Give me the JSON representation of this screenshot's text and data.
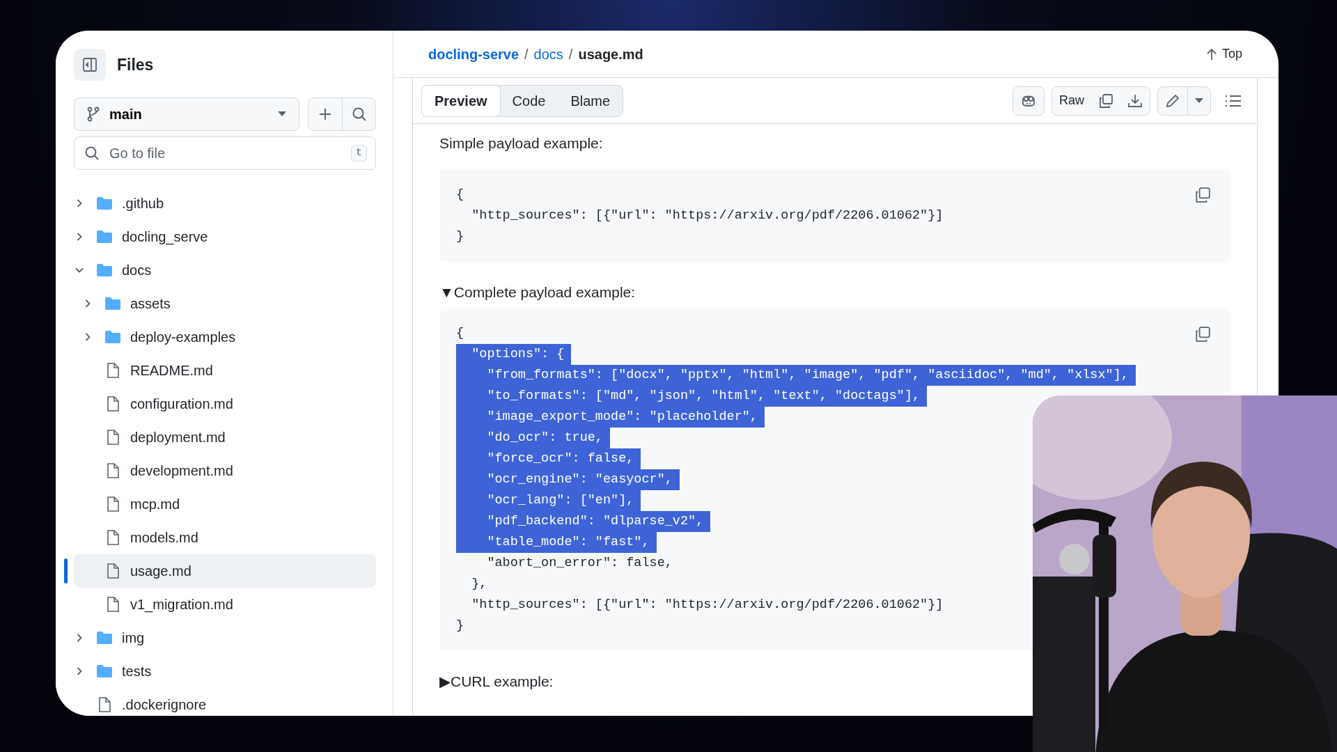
{
  "sidebar": {
    "title": "Files",
    "branch": "main",
    "search": {
      "placeholder": "Go to file",
      "shortcut": "t"
    },
    "tree": [
      {
        "kind": "folder",
        "name": ".github",
        "expanded": false,
        "selected": false
      },
      {
        "kind": "folder",
        "name": "docling_serve",
        "expanded": false,
        "selected": false
      },
      {
        "kind": "folder",
        "name": "docs",
        "expanded": true,
        "selected": false,
        "children": [
          {
            "kind": "folder",
            "name": "assets",
            "expanded": false,
            "selected": false
          },
          {
            "kind": "folder",
            "name": "deploy-examples",
            "expanded": false,
            "selected": false
          },
          {
            "kind": "file",
            "name": "README.md",
            "selected": false
          },
          {
            "kind": "file",
            "name": "configuration.md",
            "selected": false
          },
          {
            "kind": "file",
            "name": "deployment.md",
            "selected": false
          },
          {
            "kind": "file",
            "name": "development.md",
            "selected": false
          },
          {
            "kind": "file",
            "name": "mcp.md",
            "selected": false
          },
          {
            "kind": "file",
            "name": "models.md",
            "selected": false
          },
          {
            "kind": "file",
            "name": "usage.md",
            "selected": true
          },
          {
            "kind": "file",
            "name": "v1_migration.md",
            "selected": false
          }
        ]
      },
      {
        "kind": "folder",
        "name": "img",
        "expanded": false,
        "selected": false
      },
      {
        "kind": "folder",
        "name": "tests",
        "expanded": false,
        "selected": false
      },
      {
        "kind": "file",
        "name": ".dockerignore",
        "selected": false
      }
    ]
  },
  "breadcrumb": {
    "separator": "/",
    "parts": [
      {
        "text": "docling-serve",
        "link": true
      },
      {
        "text": "docs",
        "link": true
      },
      {
        "text": "usage.md",
        "link": false
      }
    ]
  },
  "top_button": "Top",
  "tabs": [
    {
      "label": "Preview",
      "selected": true
    },
    {
      "label": "Code",
      "selected": false
    },
    {
      "label": "Blame",
      "selected": false
    }
  ],
  "raw_button": "Raw",
  "content": [
    {
      "kind": "paragraph",
      "text": "Simple payload example:"
    },
    {
      "kind": "code",
      "lines": [
        {
          "text": "{",
          "selected": false
        },
        {
          "text": "  \"http_sources\": [{\"url\": \"https://arxiv.org/pdf/2206.01062\"}]",
          "selected": false
        },
        {
          "text": "}",
          "selected": false
        }
      ]
    },
    {
      "kind": "details",
      "marker": "▼",
      "summary": "Complete payload example:",
      "lines": [
        {
          "text": "{",
          "selected": false
        },
        {
          "text": "  \"options\": {",
          "selected": true
        },
        {
          "text": "    \"from_formats\": [\"docx\", \"pptx\", \"html\", \"image\", \"pdf\", \"asciidoc\", \"md\", \"xlsx\"],",
          "selected": true
        },
        {
          "text": "    \"to_formats\": [\"md\", \"json\", \"html\", \"text\", \"doctags\"],",
          "selected": true
        },
        {
          "text": "    \"image_export_mode\": \"placeholder\",",
          "selected": true
        },
        {
          "text": "    \"do_ocr\": true,",
          "selected": true
        },
        {
          "text": "    \"force_ocr\": false,",
          "selected": true
        },
        {
          "text": "    \"ocr_engine\": \"easyocr\",",
          "selected": true
        },
        {
          "text": "    \"ocr_lang\": [\"en\"],",
          "selected": true
        },
        {
          "text": "    \"pdf_backend\": \"dlparse_v2\",",
          "selected": true
        },
        {
          "text": "    \"table_mode\": \"fast\",",
          "selected": true
        },
        {
          "text": "    \"abort_on_error\": false,",
          "selected": false
        },
        {
          "text": "  },",
          "selected": false
        },
        {
          "text": "  \"http_sources\": [{\"url\": \"https://arxiv.org/pdf/2206.01062\"}]",
          "selected": false
        },
        {
          "text": "}",
          "selected": false
        }
      ]
    },
    {
      "kind": "details",
      "marker": "▶",
      "summary": "CURL example:"
    }
  ]
}
